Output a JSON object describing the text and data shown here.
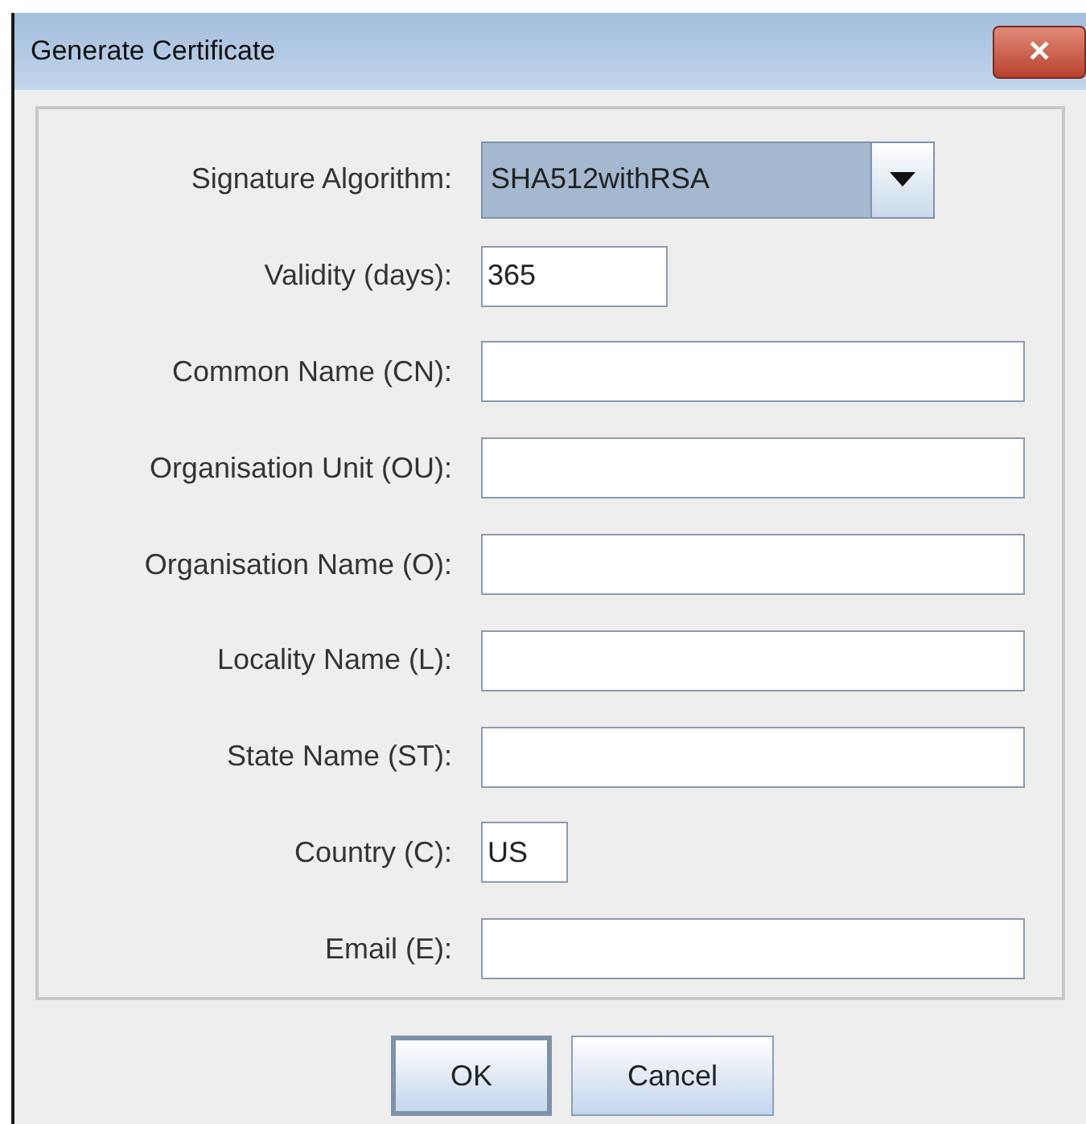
{
  "window": {
    "title": "Generate Certificate",
    "close": "✕"
  },
  "fields": [
    {
      "kind": "combo",
      "label": "Signature Algorithm:",
      "value": "SHA512withRSA"
    },
    {
      "kind": "text",
      "label": "Validity (days):",
      "value": "365"
    },
    {
      "kind": "text",
      "label": "Common Name (CN):"
    },
    {
      "kind": "text",
      "label": "Organisation Unit (OU):"
    },
    {
      "kind": "text",
      "label": "Organisation Name (O):"
    },
    {
      "kind": "text",
      "label": "Locality Name (L):"
    },
    {
      "kind": "text",
      "label": "State Name (ST):"
    },
    {
      "kind": "text",
      "label": "Country (C):",
      "value": "US"
    },
    {
      "kind": "text",
      "label": "Email (E):"
    }
  ],
  "buttons": [
    {
      "label": "OK",
      "default": true
    },
    {
      "label": "Cancel",
      "default": false
    }
  ]
}
